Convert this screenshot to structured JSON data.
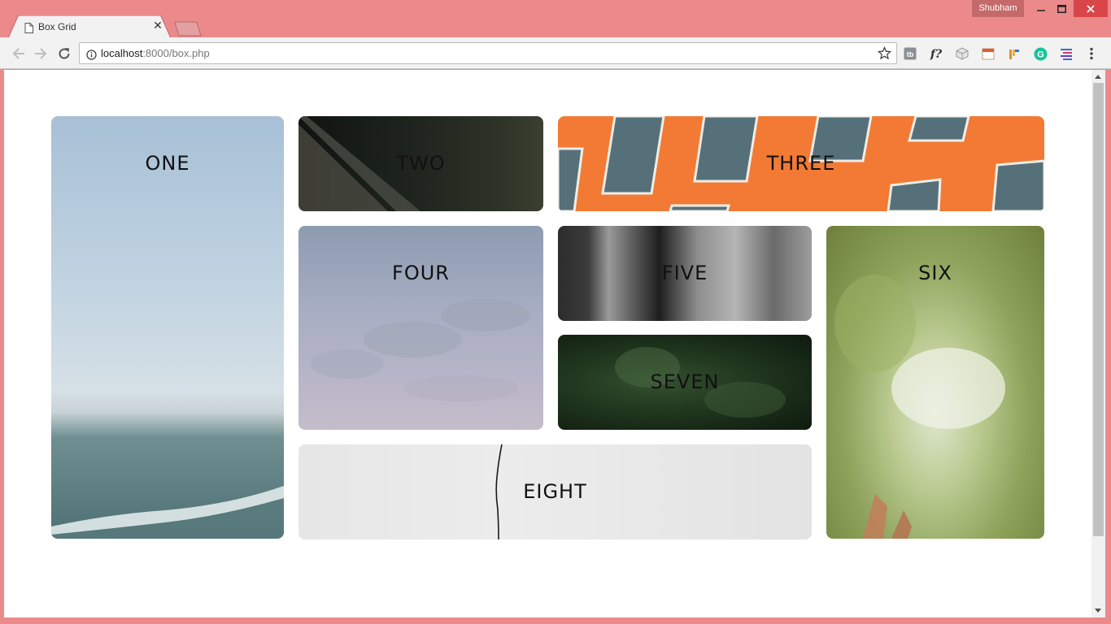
{
  "window": {
    "profile_name": "Shubham",
    "colors": {
      "frame": "#ec8a8b",
      "close_button": "#d9464a"
    }
  },
  "tab": {
    "title": "Box Grid",
    "icon": "page-icon",
    "close_glyph": "✕"
  },
  "toolbar": {
    "url_host": "localhost",
    "url_rest": ":8000/box.php",
    "extensions": [
      "tb-icon",
      "font-icon",
      "cube-icon",
      "calendar-icon",
      "tag-icon",
      "grammarly-icon",
      "lines-icon"
    ]
  },
  "grid": {
    "boxes": [
      {
        "label": "ONE"
      },
      {
        "label": "TWO"
      },
      {
        "label": "THREE"
      },
      {
        "label": "FOUR"
      },
      {
        "label": "FIVE"
      },
      {
        "label": "SIX"
      },
      {
        "label": "SEVEN"
      },
      {
        "label": "EIGHT"
      }
    ]
  }
}
